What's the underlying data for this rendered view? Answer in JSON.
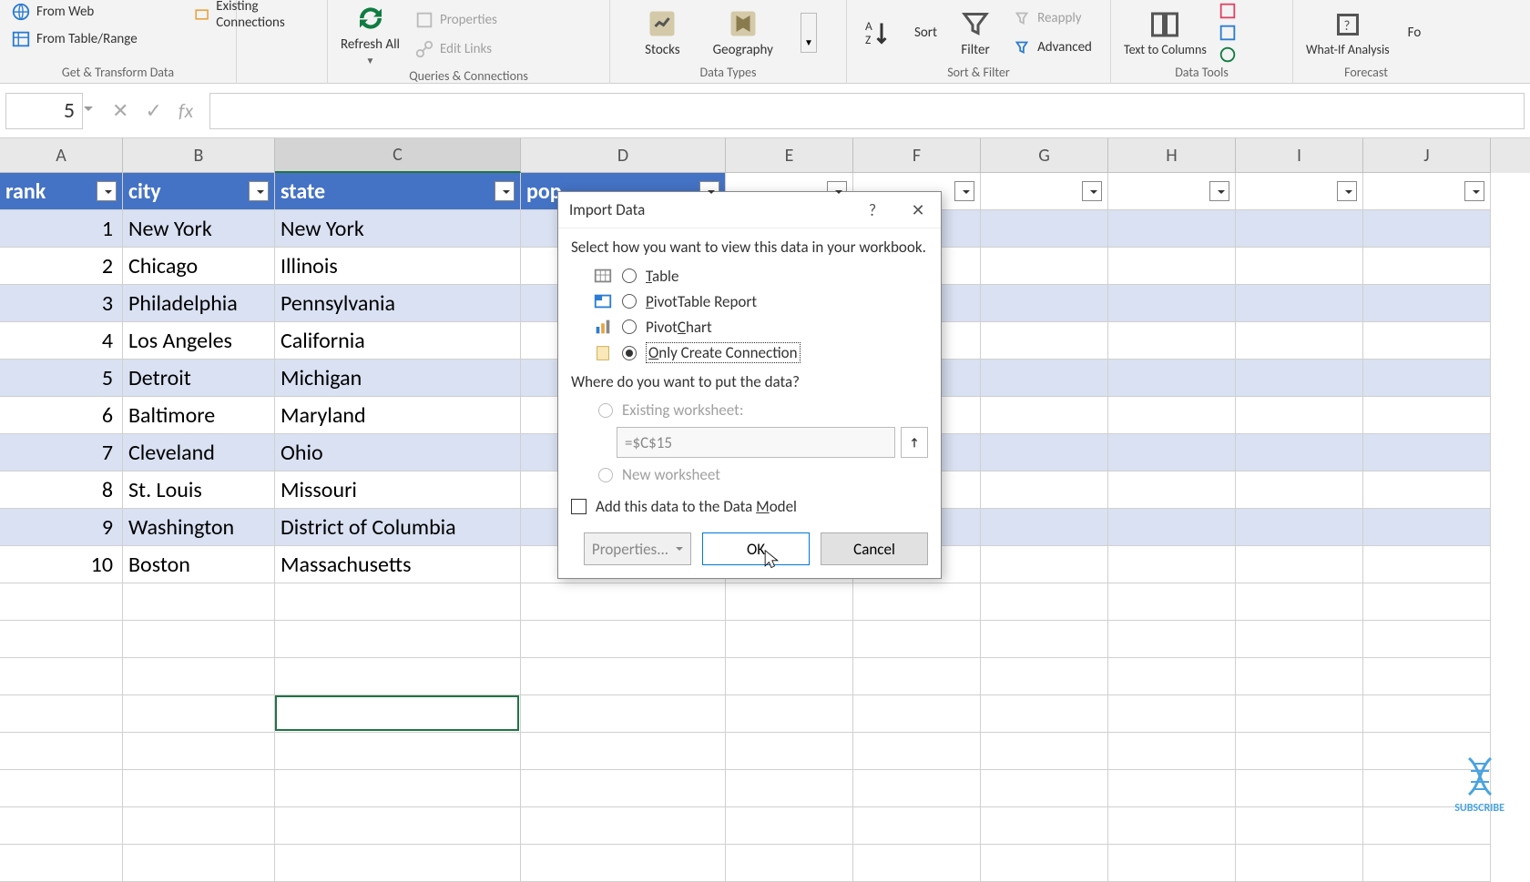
{
  "ribbon": {
    "get_transform": {
      "from_web": "From Web",
      "from_table": "From Table/Range",
      "existing_conn": "Existing Connections",
      "label": "Get & Transform Data"
    },
    "queries": {
      "refresh_all": "Refresh All",
      "properties": "Properties",
      "edit_links": "Edit Links",
      "label": "Queries & Connections"
    },
    "data_types": {
      "stocks": "Stocks",
      "geography": "Geography",
      "label": "Data Types"
    },
    "sort_filter": {
      "sort": "Sort",
      "filter": "Filter",
      "reapply": "Reapply",
      "advanced": "Advanced",
      "label": "Sort & Filter"
    },
    "data_tools": {
      "text_to_cols": "Text to Columns",
      "label": "Data Tools"
    },
    "forecast": {
      "whatif": "What-If Analysis",
      "fo": "Fo",
      "label": "Forecast"
    }
  },
  "formula_bar": {
    "name_box": "5",
    "cancel": "✕",
    "enter": "✓",
    "fx": "fx"
  },
  "columns": [
    "A",
    "B",
    "C",
    "D",
    "E",
    "F",
    "G",
    "H",
    "I",
    "J"
  ],
  "table": {
    "headers": [
      "rank",
      "city",
      "state",
      "pop"
    ],
    "rows": [
      {
        "rank": "1",
        "city": "New York",
        "state": "New York"
      },
      {
        "rank": "2",
        "city": "Chicago",
        "state": "Illinois"
      },
      {
        "rank": "3",
        "city": "Philadelphia",
        "state": "Pennsylvania"
      },
      {
        "rank": "4",
        "city": "Los Angeles",
        "state": "California"
      },
      {
        "rank": "5",
        "city": "Detroit",
        "state": "Michigan"
      },
      {
        "rank": "6",
        "city": "Baltimore",
        "state": "Maryland"
      },
      {
        "rank": "7",
        "city": "Cleveland",
        "state": "Ohio"
      },
      {
        "rank": "8",
        "city": "St. Louis",
        "state": "Missouri"
      },
      {
        "rank": "9",
        "city": "Washington",
        "state": "District of Columbia"
      },
      {
        "rank": "10",
        "city": "Boston",
        "state": "Massachusetts"
      }
    ]
  },
  "dialog": {
    "title": "Import Data",
    "prompt": "Select how you want to view this data in your workbook.",
    "opt_table": "Table",
    "opt_pivot": "PivotTable Report",
    "opt_pchart": "PivotChart",
    "opt_conn": "Only Create Connection",
    "where_prompt": "Where do you want to put the data?",
    "existing_ws": "Existing worksheet:",
    "cell_ref": "=$C$15",
    "new_ws": "New worksheet",
    "data_model": "Add this data to the Data Model",
    "properties": "Properties...",
    "ok": "OK",
    "cancel": "Cancel"
  },
  "subscribe": "SUBSCRIBE"
}
